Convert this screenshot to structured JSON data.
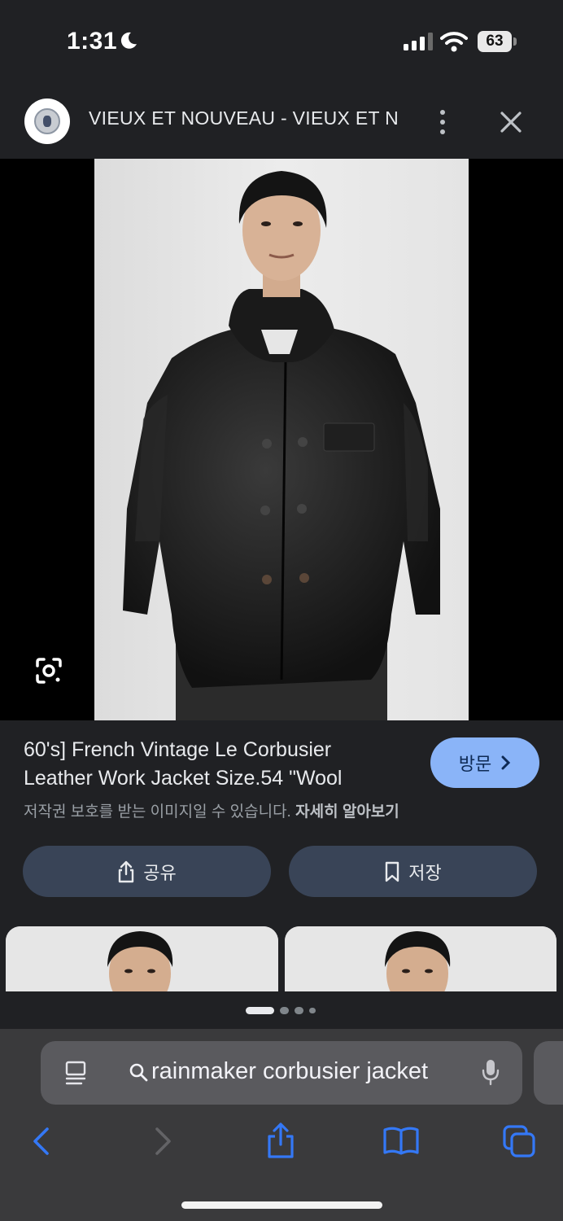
{
  "status": {
    "time": "1:31",
    "battery": "63"
  },
  "header": {
    "site_title": "VIEUX ET NOUVEAU - VIEUX ET N···"
  },
  "result": {
    "title_line1": "60's] French Vintage Le Corbusier",
    "title_line2": "Leather Work Jacket Size.54 \"Wool",
    "copyright": "저작권 보호를 받는 이미지일 수 있습니다.",
    "learn_more": "자세히 알아보기",
    "visit_label": "방문",
    "share_label": "공유",
    "save_label": "저장"
  },
  "search": {
    "query": "rainmaker corbusier jacket"
  },
  "colors": {
    "accent": "#8ab4f8",
    "safari_blue": "#3478f6",
    "background": "#202124"
  }
}
